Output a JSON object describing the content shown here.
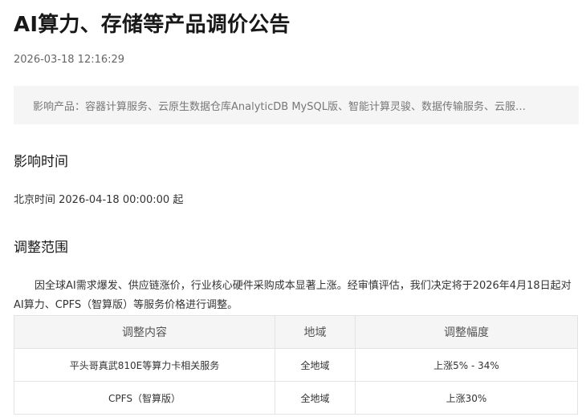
{
  "title": "AI算力、存储等产品调价公告",
  "timestamp": "2026-03-18 12:16:29",
  "affected_products": "影响产品：容器计算服务、云原生数据仓库AnalyticDB MySQL版、智能计算灵骏、数据传输服务、云服…",
  "sections": {
    "time_heading": "影响时间",
    "time_value": "北京时间 2026-04-18 00:00:00 起",
    "scope_heading": "调整范围",
    "scope_paragraph": "因全球AI需求爆发、供应链涨价，行业核心硬件采购成本显著上涨。经审慎评估，我们决定将于2026年4月18日起对AI算力、CPFS（智算版）等服务价格进行调整。"
  },
  "table": {
    "headers": [
      "调整内容",
      "地域",
      "调整幅度"
    ],
    "rows": [
      [
        "平头哥真武810E等算力卡相关服务",
        "全地域",
        "上涨5% - 34%"
      ],
      [
        "CPFS（智算版）",
        "全地域",
        "上涨30%"
      ]
    ]
  }
}
